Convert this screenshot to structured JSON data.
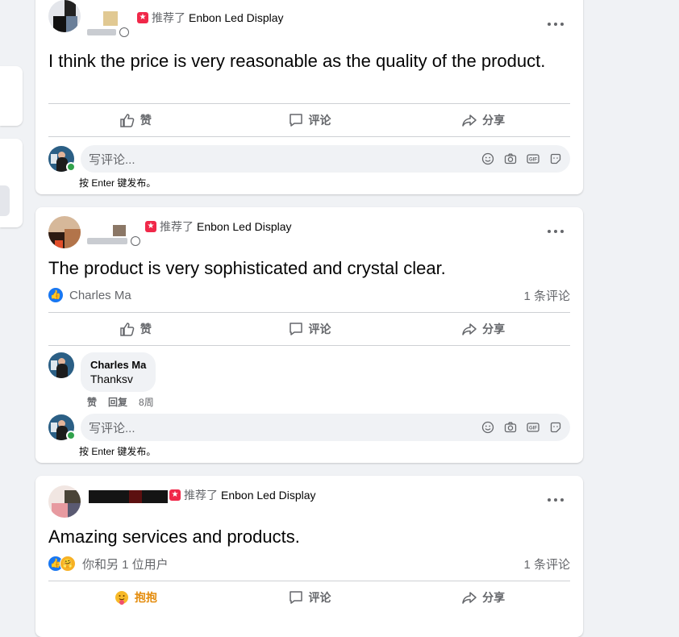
{
  "posts": [
    {
      "page_name": "Enbon Led Display",
      "recommend_text": "推荐了",
      "body": "I think the price is very reasonable as the quality of the product.",
      "actions": {
        "like": "赞",
        "comment": "评论",
        "share": "分享"
      },
      "comment_placeholder": "写评论...",
      "hint": "按 Enter 键发布。"
    },
    {
      "page_name": "Enbon Led Display",
      "recommend_text": "推荐了",
      "body": "The product is very sophisticated and crystal clear.",
      "reactors": "Charles Ma",
      "comment_count": "1 条评论",
      "actions": {
        "like": "赞",
        "comment": "评论",
        "share": "分享"
      },
      "reply": {
        "author": "Charles Ma",
        "text": "Thanksv",
        "like": "赞",
        "reply": "回复",
        "time": "8周"
      },
      "comment_placeholder": "写评论...",
      "hint": "按 Enter 键发布。"
    },
    {
      "page_name": "Enbon Led Display",
      "recommend_text": "推荐了",
      "body": "Amazing services and products.",
      "reactors": "你和另 1 位用户",
      "comment_count": "1 条评论",
      "actions": {
        "hug": "抱抱",
        "comment": "评论",
        "share": "分享"
      }
    }
  ],
  "colors": {
    "accent": "#1877f2",
    "recommend": "#f02849",
    "online": "#31a24c",
    "hug": "#e48c0c"
  },
  "icons": [
    "more-icon",
    "globe-icon",
    "like-icon",
    "comment-icon",
    "share-icon",
    "emoji-icon",
    "camera-icon",
    "gif-icon",
    "sticker-icon",
    "hug-icon"
  ]
}
